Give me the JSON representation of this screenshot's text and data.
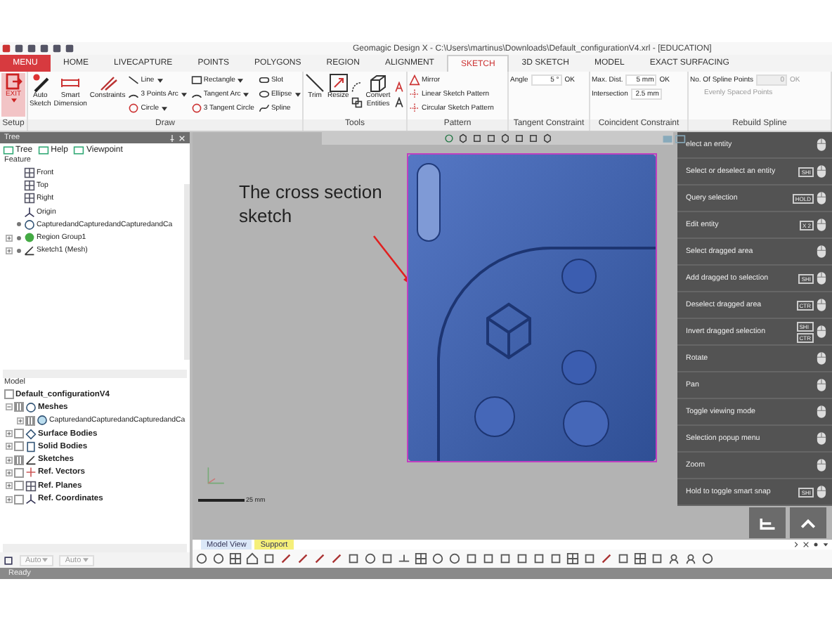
{
  "window": {
    "title": "Geomagic Design X - C:\\Users\\martinus\\Downloads\\Default_configurationV4.xrl - [EDUCATION]"
  },
  "tabs": [
    {
      "label": "MENU",
      "kind": "menu",
      "selected": false
    },
    {
      "label": "HOME",
      "kind": "tab",
      "selected": false
    },
    {
      "label": "LIVECAPTURE",
      "kind": "tab",
      "selected": false
    },
    {
      "label": "POINTS",
      "kind": "tab",
      "selected": false
    },
    {
      "label": "POLYGONS",
      "kind": "tab",
      "selected": false
    },
    {
      "label": "REGION",
      "kind": "tab",
      "selected": false
    },
    {
      "label": "ALIGNMENT",
      "kind": "tab",
      "selected": false
    },
    {
      "label": "SKETCH",
      "kind": "tab",
      "selected": true
    },
    {
      "label": "3D SKETCH",
      "kind": "tab",
      "selected": false
    },
    {
      "label": "MODEL",
      "kind": "tab",
      "selected": false
    },
    {
      "label": "EXACT SURFACING",
      "kind": "tab",
      "selected": false
    }
  ],
  "ribbon": {
    "groups": [
      {
        "label": "Setup",
        "kind": "tools",
        "tools": [
          {
            "label": "EXIT",
            "kind": "exit",
            "dropdown": true
          }
        ]
      },
      {
        "label": "Draw",
        "kind": "tools",
        "tools": [
          {
            "label": "Auto Sketch",
            "kind": "large",
            "dropdown": false
          },
          {
            "label": "Smart Dimension",
            "kind": "large",
            "dropdown": false
          },
          {
            "label": "Constraints",
            "kind": "large",
            "dropdown": false
          },
          {
            "label": "Line",
            "kind": "small",
            "dropdown": true
          },
          {
            "label": "3 Points Arc",
            "kind": "small",
            "dropdown": true
          },
          {
            "label": "Circle",
            "kind": "small",
            "dropdown": true
          },
          {
            "label": "Rectangle",
            "kind": "small",
            "dropdown": true
          },
          {
            "label": "Tangent Arc",
            "kind": "small",
            "dropdown": true
          },
          {
            "label": "3 Tangent Circle",
            "kind": "small",
            "dropdown": false
          },
          {
            "label": "Slot",
            "kind": "small",
            "dropdown": false
          },
          {
            "label": "Ellipse",
            "kind": "small",
            "dropdown": true
          },
          {
            "label": "Spline",
            "kind": "small",
            "dropdown": false
          }
        ]
      },
      {
        "label": "Tools",
        "kind": "tools",
        "tools": [
          {
            "label": "Trim",
            "kind": "large",
            "dropdown": false
          },
          {
            "label": "Resize",
            "kind": "large",
            "dropdown": false
          },
          {
            "label": "Convert Entities",
            "kind": "large",
            "dropdown": false
          }
        ]
      },
      {
        "label": "Pattern",
        "kind": "tools",
        "tools": [
          {
            "label": "Mirror",
            "kind": "small",
            "dropdown": false
          },
          {
            "label": "Linear Sketch Pattern",
            "kind": "small",
            "dropdown": false
          },
          {
            "label": "Circular Sketch Pattern",
            "kind": "small",
            "dropdown": false
          }
        ]
      },
      {
        "label": "Tangent Constraint",
        "kind": "form",
        "rows": [
          {
            "kind": "field",
            "label": "Angle",
            "value": "5 °",
            "button": "OK",
            "disabled": false
          }
        ]
      },
      {
        "label": "Coincident Constraint",
        "kind": "form",
        "rows": [
          {
            "kind": "field",
            "label": "Max. Dist.",
            "value": "5 mm",
            "button": "OK",
            "disabled": false
          },
          {
            "kind": "field",
            "label": "Intersection",
            "value": "2.5 mm",
            "disabled": false
          }
        ]
      },
      {
        "label": "Rebuild Spline",
        "kind": "form",
        "rows": [
          {
            "kind": "field",
            "label": "No. Of Spline Points",
            "value": "0",
            "button": "OK",
            "disabled": true
          },
          {
            "kind": "option",
            "label": "Evenly Spaced Points",
            "disabled": true
          }
        ]
      }
    ]
  },
  "tree_panel": {
    "title": "Tree",
    "tabs": [
      "Tree",
      "Help",
      "Viewpoint"
    ],
    "section": "Feature",
    "items": [
      {
        "label": "Front",
        "kind": "plane",
        "expandable": false,
        "visible": false
      },
      {
        "label": "Top",
        "kind": "plane",
        "expandable": false,
        "visible": false
      },
      {
        "label": "Right",
        "kind": "plane",
        "expandable": false,
        "visible": false
      },
      {
        "label": "Origin",
        "kind": "origin",
        "expandable": false,
        "visible": false
      },
      {
        "label": "CapturedandCapturedandCapturedandCa",
        "kind": "mesh",
        "expandable": false,
        "visible": true
      },
      {
        "label": "Region Group1",
        "kind": "region",
        "expandable": true,
        "visible": true
      },
      {
        "label": "Sketch1 (Mesh)",
        "kind": "sketch",
        "expandable": true,
        "visible": true
      }
    ]
  },
  "model_panel": {
    "title": "Model",
    "root": {
      "label": "Default_configurationV4",
      "checked": false
    },
    "items": [
      {
        "label": "Meshes",
        "kind": "mesh",
        "checked": true,
        "expanded": true,
        "children": [
          {
            "label": "CapturedandCapturedandCapturedandCa",
            "kind": "mesh",
            "checked": true,
            "expanded": false
          }
        ]
      },
      {
        "label": "Surface Bodies",
        "kind": "surface",
        "checked": false,
        "expanded": false
      },
      {
        "label": "Solid Bodies",
        "kind": "solid",
        "checked": false,
        "expanded": false
      },
      {
        "label": "Sketches",
        "kind": "sketch",
        "checked": true,
        "expanded": false
      },
      {
        "label": "Ref. Vectors",
        "kind": "vector",
        "checked": false,
        "expanded": false
      },
      {
        "label": "Ref. Planes",
        "kind": "plane",
        "checked": false,
        "expanded": false
      },
      {
        "label": "Ref. Coordinates",
        "kind": "origin",
        "checked": false,
        "expanded": false
      }
    ]
  },
  "viewport": {
    "annotation": "The cross section sketch",
    "scale_bar": "25 mm",
    "shortcuts": [
      {
        "action": "elect an entity"
      },
      {
        "action": "Select or deselect an entity",
        "keys": [
          "SHI"
        ]
      },
      {
        "action": "Query selection",
        "keys": [
          "HOLD"
        ]
      },
      {
        "action": "Edit entity",
        "keys": [
          "X 2"
        ]
      },
      {
        "action": "Select dragged area"
      },
      {
        "action": "Add dragged to selection",
        "keys": [
          "SHI"
        ]
      },
      {
        "action": "Deselect dragged area",
        "keys": [
          "CTR"
        ]
      },
      {
        "action": "Invert dragged selection",
        "keys": [
          "SHI",
          "CTR"
        ]
      },
      {
        "action": "Rotate"
      },
      {
        "action": "Pan"
      },
      {
        "action": "Toggle viewing mode"
      },
      {
        "action": "Selection popup menu"
      },
      {
        "action": "Zoom"
      },
      {
        "action": "Hold to toggle smart snap",
        "keys": [
          "SHI"
        ]
      }
    ],
    "view_tabs": [
      {
        "label": "Model View",
        "color": "#dbe8f8"
      },
      {
        "label": "Support",
        "color": "#f5ef7a"
      }
    ]
  },
  "bottom_toolbar": {
    "fields": [
      "Auto",
      "Auto"
    ]
  },
  "status_bar": {
    "text": "Ready"
  }
}
